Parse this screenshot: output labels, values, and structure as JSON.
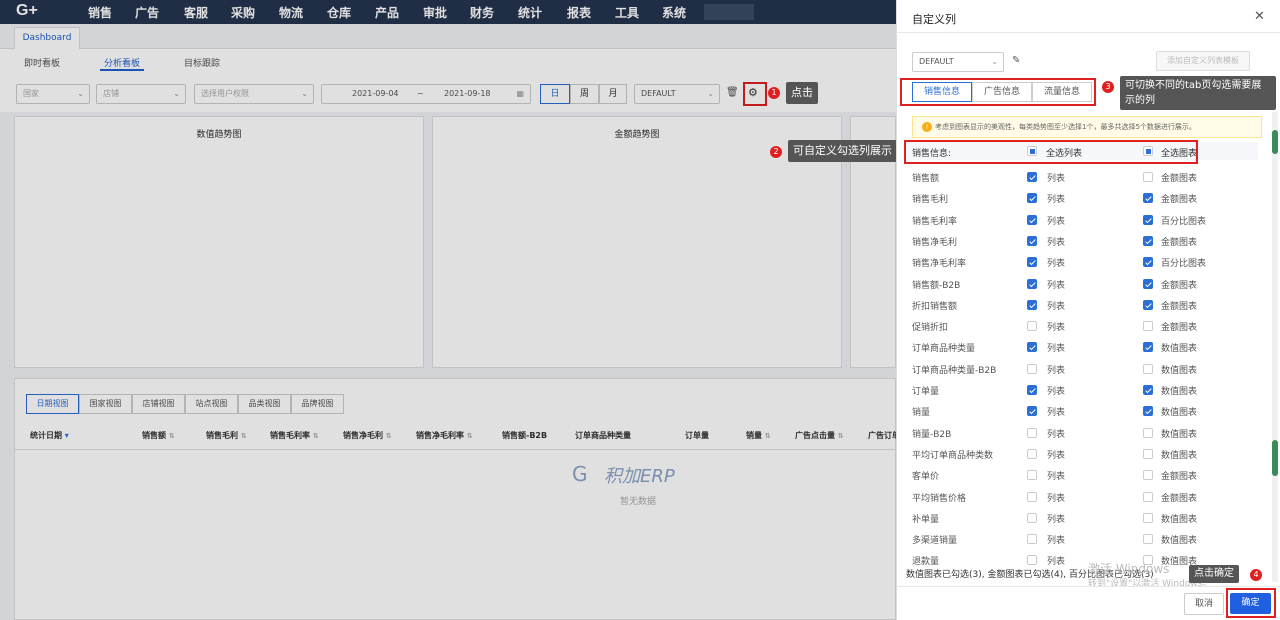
{
  "nav": {
    "logo": "G+",
    "items": [
      "销售",
      "广告",
      "客服",
      "采购",
      "物流",
      "仓库",
      "产品",
      "审批",
      "财务",
      "统计",
      "报表",
      "工具",
      "系统"
    ]
  },
  "dashboard_tab": "Dashboard",
  "subtabs": [
    "即时看板",
    "分析看板",
    "目标跟踪"
  ],
  "filters": {
    "country": "国家",
    "shop": "店铺",
    "permission": "选择用户权限",
    "date_start": "2021-09-04",
    "date_sep": "~",
    "date_end": "2021-09-18",
    "day": "日",
    "week": "周",
    "month": "月",
    "template": "DEFAULT"
  },
  "panels": {
    "count_trend": "数值趋势图",
    "amount_trend": "金额趋势图"
  },
  "view_tabs": [
    "日期视图",
    "国家视图",
    "店铺视图",
    "站点视图",
    "品类视图",
    "品牌视图"
  ],
  "table_headers": [
    "统计日期",
    "销售额",
    "销售毛利",
    "销售毛利率",
    "销售净毛利",
    "销售净毛利率",
    "销售额-B2B",
    "订单商品种类量",
    "订单量",
    "销量",
    "广告点击量",
    "广告订单"
  ],
  "empty": {
    "brand": "积加ERP",
    "text": "暂无数据"
  },
  "drawer": {
    "title": "自定义列",
    "template_value": "DEFAULT",
    "add_template": "添加自定义列表模板",
    "tabs": [
      "销售信息",
      "广告信息",
      "流量信息"
    ],
    "notice": "考虑到图表显示的美观性，每类趋势图至少选择1个，最多共选择5个数据进行展示。",
    "header": {
      "label": "销售信息:",
      "all_list": "全选列表",
      "all_chart": "全选图表"
    },
    "rows": [
      {
        "name": "销售额",
        "list": "列表",
        "list_on": true,
        "chart": "金额图表",
        "chart_on": false
      },
      {
        "name": "销售毛利",
        "list": "列表",
        "list_on": true,
        "chart": "金额图表",
        "chart_on": true
      },
      {
        "name": "销售毛利率",
        "list": "列表",
        "list_on": true,
        "chart": "百分比图表",
        "chart_on": true
      },
      {
        "name": "销售净毛利",
        "list": "列表",
        "list_on": true,
        "chart": "金额图表",
        "chart_on": true
      },
      {
        "name": "销售净毛利率",
        "list": "列表",
        "list_on": true,
        "chart": "百分比图表",
        "chart_on": true
      },
      {
        "name": "销售额-B2B",
        "list": "列表",
        "list_on": true,
        "chart": "金额图表",
        "chart_on": true
      },
      {
        "name": "折扣销售额",
        "list": "列表",
        "list_on": true,
        "chart": "金额图表",
        "chart_on": true
      },
      {
        "name": "促销折扣",
        "list": "列表",
        "list_on": false,
        "chart": "金额图表",
        "chart_on": false
      },
      {
        "name": "订单商品种类量",
        "list": "列表",
        "list_on": true,
        "chart": "数值图表",
        "chart_on": true
      },
      {
        "name": "订单商品种类量-B2B",
        "list": "列表",
        "list_on": false,
        "chart": "数值图表",
        "chart_on": false
      },
      {
        "name": "订单量",
        "list": "列表",
        "list_on": true,
        "chart": "数值图表",
        "chart_on": true
      },
      {
        "name": "销量",
        "list": "列表",
        "list_on": true,
        "chart": "数值图表",
        "chart_on": true
      },
      {
        "name": "销量-B2B",
        "list": "列表",
        "list_on": false,
        "chart": "数值图表",
        "chart_on": false
      },
      {
        "name": "平均订单商品种类数",
        "list": "列表",
        "list_on": false,
        "chart": "数值图表",
        "chart_on": false
      },
      {
        "name": "客单价",
        "list": "列表",
        "list_on": false,
        "chart": "金额图表",
        "chart_on": false
      },
      {
        "name": "平均销售价格",
        "list": "列表",
        "list_on": false,
        "chart": "金额图表",
        "chart_on": false
      },
      {
        "name": "补单量",
        "list": "列表",
        "list_on": false,
        "chart": "数值图表",
        "chart_on": false
      },
      {
        "name": "多渠道销量",
        "list": "列表",
        "list_on": false,
        "chart": "数值图表",
        "chart_on": false
      },
      {
        "name": "退款量",
        "list": "列表",
        "list_on": false,
        "chart": "数值图表",
        "chart_on": false
      }
    ],
    "footer_status": "数值图表已勾选(3), 金额图表已勾选(4), 百分比图表已勾选(3)",
    "cancel": "取消",
    "confirm": "确定",
    "watermark_line1": "激活 Windows",
    "watermark_line2": "转到\"设置\"以激活 Windows。"
  },
  "annotations": {
    "n1": "1",
    "c1": "点击",
    "n2": "2",
    "c2": "可自定义勾选列展示",
    "n3": "3",
    "c3": "可切换不同的tab页勾选需要展示的列",
    "n4": "4",
    "c4": "点击确定"
  },
  "colors": {
    "nav_bg": "#24344f",
    "accent": "#2b6fd6",
    "annotation_red": "#e02020"
  }
}
